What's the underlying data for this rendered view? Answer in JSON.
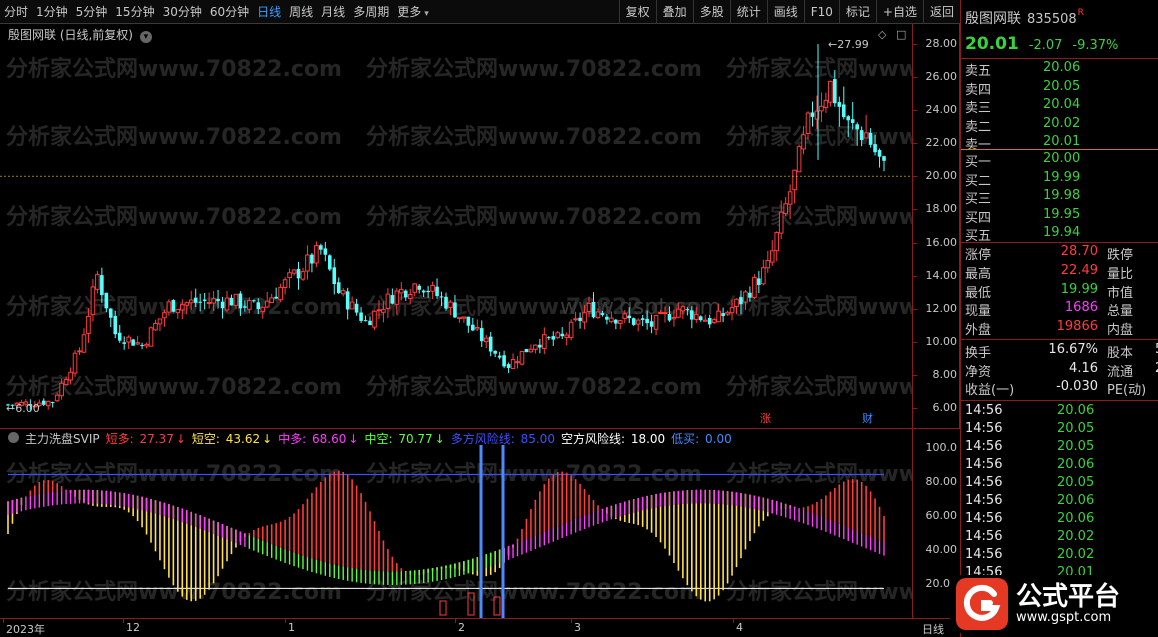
{
  "toolbar": {
    "periods": [
      "分时",
      "1分钟",
      "5分钟",
      "15分钟",
      "30分钟",
      "60分钟",
      "日线",
      "周线",
      "月线",
      "多周期",
      "更多"
    ],
    "active_period": "日线",
    "tools": [
      "复权",
      "叠加",
      "多股",
      "统计",
      "画线",
      "F10",
      "标记",
      "+自选",
      "返回"
    ]
  },
  "chart": {
    "title": "殷图网联 (日线,前复权)",
    "y_ticks": [
      "28.00",
      "26.00",
      "24.00",
      "22.00",
      "20.00",
      "18.00",
      "16.00",
      "14.00",
      "12.00",
      "10.00",
      "8.00",
      "6.00"
    ],
    "high_marker": "27.99",
    "low_marker": "6.00",
    "badges": [
      "涨",
      "财"
    ],
    "watermark_site": "分析家公式网www.70822.com",
    "watermark_center": "www.gspt.com"
  },
  "indicator": {
    "name": "主力洗盘SVIP",
    "items": [
      {
        "label": "短多:",
        "value": "27.37",
        "color": "#ff3c3c",
        "arrow": "↓",
        "arrow_color": "#ff3c3c"
      },
      {
        "label": "短空:",
        "value": "43.62",
        "color": "#ffe14a",
        "arrow": "↓",
        "arrow_color": "#ffe14a"
      },
      {
        "label": "中多:",
        "value": "68.60",
        "color": "#ff3cff",
        "arrow": "↓",
        "arrow_color": "#ff3cff"
      },
      {
        "label": "中空:",
        "value": "70.77",
        "color": "#5cff3c",
        "arrow": "↓",
        "arrow_color": "#5cff3c"
      },
      {
        "label": "多方风险线:",
        "value": "85.00",
        "color": "#3c50ff",
        "arrow": "",
        "arrow_color": ""
      },
      {
        "label": "空方风险线:",
        "value": "18.00",
        "color": "#ffffff",
        "arrow": "",
        "arrow_color": ""
      },
      {
        "label": "低买:",
        "value": "0.00",
        "color": "#3c8cff",
        "arrow": "",
        "arrow_color": ""
      }
    ],
    "y_ticks": [
      "100.0",
      "80.00",
      "60.00",
      "40.00",
      "20.00"
    ]
  },
  "xaxis": {
    "labels": [
      "2023年",
      "12",
      "1",
      "2",
      "3",
      "4"
    ],
    "period_label": "日线"
  },
  "quote": {
    "name": "殷图网联",
    "code": "835508",
    "tag": "R",
    "price": "20.01",
    "change": "-2.07",
    "pct": "-9.37%",
    "asks": [
      {
        "label": "卖五",
        "price": "20.06"
      },
      {
        "label": "卖四",
        "price": "20.05"
      },
      {
        "label": "卖三",
        "price": "20.04"
      },
      {
        "label": "卖二",
        "price": "20.02"
      },
      {
        "label": "卖一",
        "price": "20.01"
      }
    ],
    "bids": [
      {
        "label": "买一",
        "price": "20.00"
      },
      {
        "label": "买二",
        "price": "19.99"
      },
      {
        "label": "买三",
        "price": "19.98"
      },
      {
        "label": "买四",
        "price": "19.95"
      },
      {
        "label": "买五",
        "price": "19.94"
      }
    ],
    "stats": [
      {
        "l1": "涨停",
        "v1": "28.70",
        "c1": "#ff3c3c",
        "l2": "跌停"
      },
      {
        "l1": "最高",
        "v1": "22.49",
        "c1": "#ff3c3c",
        "l2": "量比"
      },
      {
        "l1": "最低",
        "v1": "19.99",
        "c1": "#3cd23c",
        "l2": "市值"
      },
      {
        "l1": "现量",
        "v1": "1686",
        "c1": "#ff3cff",
        "l2": "总量"
      },
      {
        "l1": "外盘",
        "v1": "19866",
        "c1": "#ff3c3c",
        "l2": "内盘"
      }
    ],
    "fin": [
      {
        "l1": "换手",
        "v1": "16.67%",
        "l2": "股本",
        "v2": "5"
      },
      {
        "l1": "净资",
        "v1": "4.16",
        "l2": "流通",
        "v2": "2"
      },
      {
        "l1": "收益(一)",
        "v1": "-0.030",
        "l2": "PE(动)",
        "v2": ""
      }
    ],
    "ticks": [
      {
        "time": "14:56",
        "price": "20.06"
      },
      {
        "time": "14:56",
        "price": "20.05"
      },
      {
        "time": "14:56",
        "price": "20.05"
      },
      {
        "time": "14:56",
        "price": "20.06"
      },
      {
        "time": "14:56",
        "price": "20.05"
      },
      {
        "time": "14:56",
        "price": "20.06"
      },
      {
        "time": "14:56",
        "price": "20.06"
      },
      {
        "time": "14:56",
        "price": "20.02"
      },
      {
        "time": "14:56",
        "price": "20.02"
      },
      {
        "time": "14:56",
        "price": "20.01"
      }
    ]
  },
  "logo": {
    "text": "公式平台",
    "url": "www.gspt.com"
  }
}
